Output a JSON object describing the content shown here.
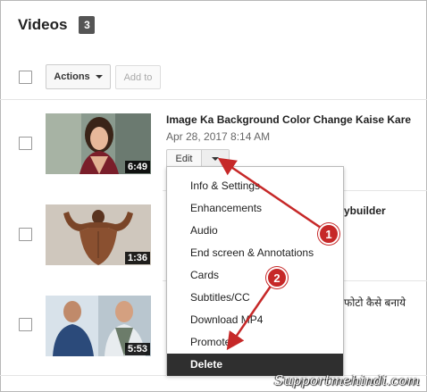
{
  "header": {
    "title": "Videos",
    "count": "3"
  },
  "toolbar": {
    "actions_label": "Actions",
    "add_to_label": "Add to"
  },
  "videos": [
    {
      "title": "Image Ka Background Color Change Kaise Kare",
      "date": "Apr 28, 2017 8:14 AM",
      "duration": "6:49"
    },
    {
      "title_fragment": "ybuilder",
      "duration": "1:36"
    },
    {
      "title_fragment": "फोटो कैसे बनाये",
      "duration": "5:53"
    }
  ],
  "edit_button": {
    "label": "Edit"
  },
  "menu": {
    "items": [
      {
        "label": "Info & Settings"
      },
      {
        "label": "Enhancements"
      },
      {
        "label": "Audio"
      },
      {
        "label": "End screen & Annotations"
      },
      {
        "label": "Cards"
      },
      {
        "label": "Subtitles/CC"
      },
      {
        "label": "Download MP4"
      },
      {
        "label": "Promote"
      },
      {
        "label": "Delete"
      }
    ],
    "selected": "Delete"
  },
  "annotations": {
    "step1": "1",
    "step2": "2",
    "arrow_color": "#c62828"
  },
  "watermark": "Supportmehindi.com"
}
